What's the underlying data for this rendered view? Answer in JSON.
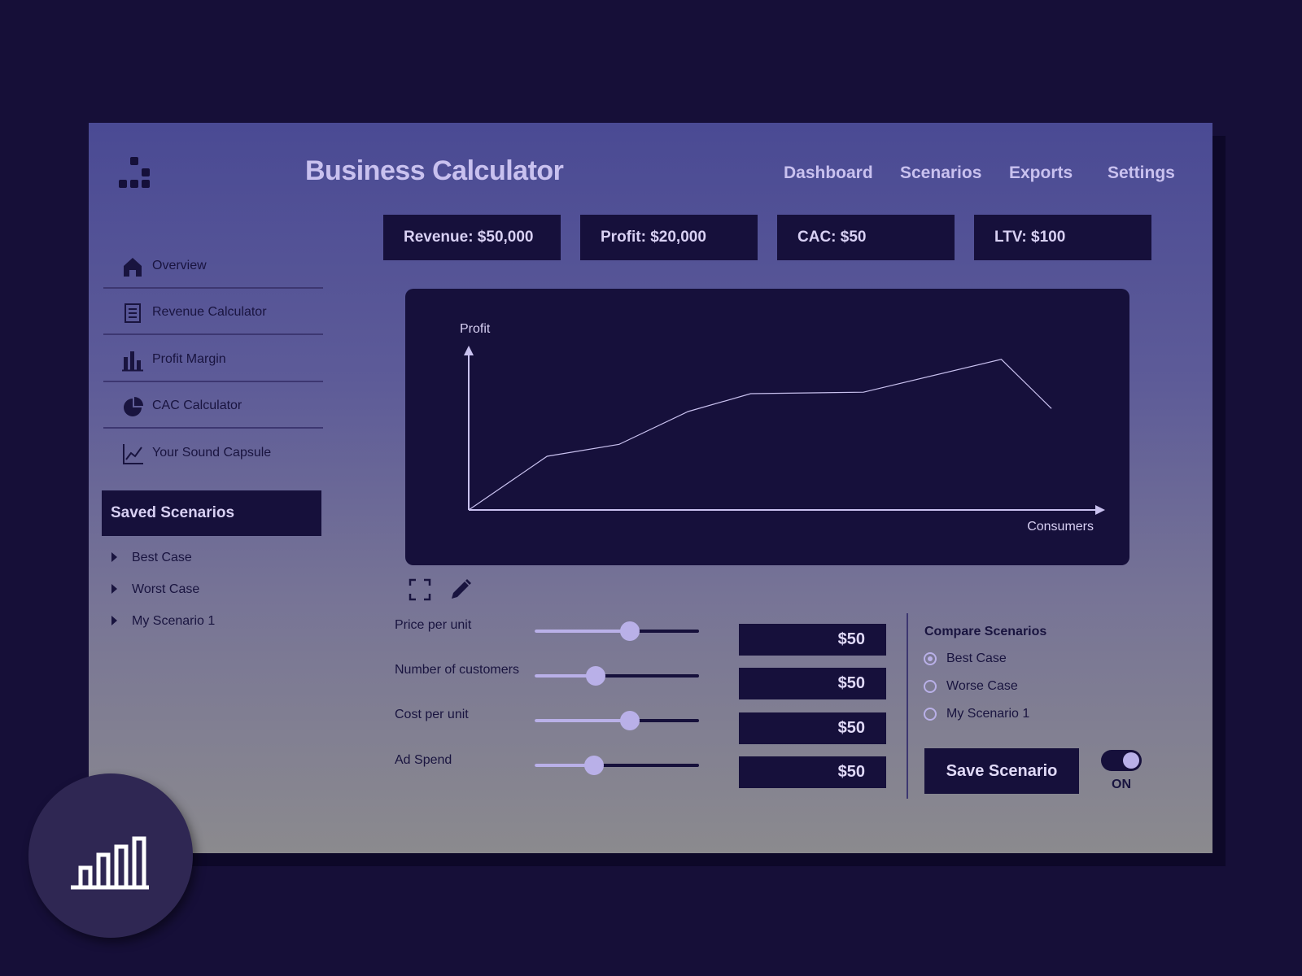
{
  "app": {
    "title": "Business Calculator",
    "logo_icon": "blocks-logo-icon"
  },
  "nav": {
    "items": [
      {
        "label": "Dashboard"
      },
      {
        "label": "Scenarios"
      },
      {
        "label": "Exports"
      },
      {
        "label": "Settings"
      }
    ]
  },
  "kpis": [
    {
      "label": "Revenue: $50,000"
    },
    {
      "label": "Profit: $20,000"
    },
    {
      "label": "CAC: $50"
    },
    {
      "label": "LTV: $100"
    }
  ],
  "sidebar": {
    "items": [
      {
        "label": "Overview",
        "icon": "home-icon"
      },
      {
        "label": "Revenue Calculator",
        "icon": "document-icon"
      },
      {
        "label": "Profit Margin",
        "icon": "bar-chart-icon"
      },
      {
        "label": "CAC Calculator",
        "icon": "pie-chart-icon"
      },
      {
        "label": "Your Sound Capsule",
        "icon": "line-chart-icon"
      }
    ],
    "saved_header": "Saved Scenarios",
    "saved_items": [
      {
        "label": "Best Case"
      },
      {
        "label": "Worst Case"
      },
      {
        "label": "My Scenario 1"
      }
    ]
  },
  "chart_data": {
    "type": "line",
    "title": "",
    "xlabel": "Consumers",
    "ylabel": "Profit",
    "grid": false,
    "series": [
      {
        "x": [
          0,
          1.25,
          2.4,
          3.5,
          4.5,
          6.3,
          8.5,
          9.3
        ],
        "y": [
          0,
          3.6,
          4.4,
          6.6,
          7.8,
          7.9,
          10.1,
          6.8
        ]
      }
    ]
  },
  "chart_tools": {
    "expand_icon": "expand-icon",
    "edit_icon": "pencil-icon"
  },
  "sliders": [
    {
      "label": "Price per unit",
      "value": "$50",
      "level": 0.58
    },
    {
      "label": "Number of customers",
      "value": "$50",
      "level": 0.37
    },
    {
      "label": "Cost per unit",
      "value": "$50",
      "level": 0.58
    },
    {
      "label": "Ad Spend",
      "value": "$50",
      "level": 0.36
    }
  ],
  "compare": {
    "title": "Compare Scenarios",
    "options": [
      {
        "label": "Best Case",
        "selected": true
      },
      {
        "label": "Worse Case",
        "selected": false
      },
      {
        "label": "My Scenario 1",
        "selected": false
      }
    ]
  },
  "actions": {
    "save_label": "Save Scenario",
    "toggle_label": "ON",
    "toggle_on": true
  },
  "fab": {
    "icon": "bar-chart-icon"
  },
  "colors": {
    "background": "#160f38",
    "panel": "#16103b",
    "accent": "#b9b0e8",
    "text_light": "#c9c1ef",
    "text_dark": "#19143f"
  }
}
